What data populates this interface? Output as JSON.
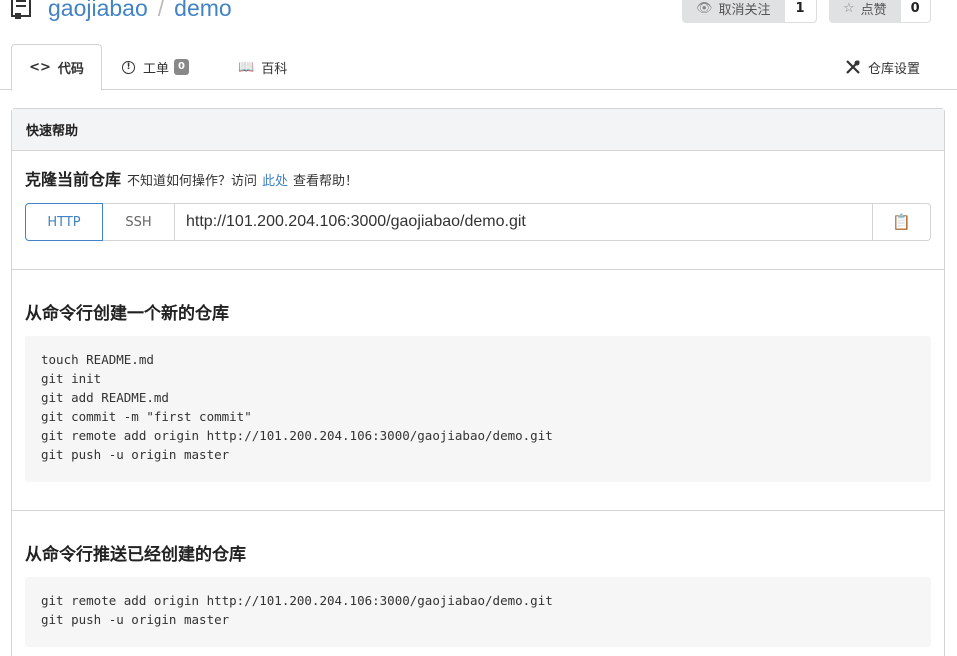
{
  "header": {
    "owner": "gaojiabao",
    "separator": "/",
    "repo": "demo",
    "watch_label": "取消关注",
    "watch_count": "1",
    "star_label": "点赞",
    "star_count": "0"
  },
  "tabs": {
    "code": "代码",
    "issues": "工单",
    "issues_count": "0",
    "wiki": "百科",
    "settings": "仓库设置"
  },
  "panel": {
    "title": "快速帮助",
    "clone_heading": "克隆当前仓库",
    "clone_hint_prefix": "不知道如何操作？访问",
    "clone_hint_link": "此处",
    "clone_hint_suffix": "查看帮助！",
    "proto_http": "HTTP",
    "proto_ssh": "SSH",
    "clone_url": "http://101.200.204.106:3000/gaojiabao/demo.git"
  },
  "new_repo": {
    "title": "从命令行创建一个新的仓库",
    "commands": "touch README.md\ngit init\ngit add README.md\ngit commit -m \"first commit\"\ngit remote add origin http://101.200.204.106:3000/gaojiabao/demo.git\ngit push -u origin master"
  },
  "push_existing": {
    "title": "从命令行推送已经创建的仓库",
    "commands": "git remote add origin http://101.200.204.106:3000/gaojiabao/demo.git\ngit push -u origin master"
  },
  "colors": {
    "link": "#4183c4",
    "border": "#d4d4d5",
    "code_bg": "#f6f6f6"
  }
}
